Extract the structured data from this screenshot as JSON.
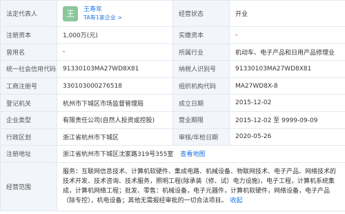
{
  "rows": {
    "legal_rep": {
      "label": "法定代表人",
      "avatar_char": "王",
      "name": "王寿年",
      "sub": "TA有1家企业 >",
      "status_label": "经营状态",
      "status_value": "开业"
    },
    "capital": {
      "label": "注册资本",
      "value": "1,000万(元)",
      "label2": "实缴资本",
      "value2": "-"
    },
    "former_name": {
      "label": "曾用名",
      "value": "-",
      "label2": "所属行业",
      "value2": "机动车、电子产品和日用产品修理业"
    },
    "credit_code": {
      "label": "统一社会信用代码",
      "value": "91330103MA27WD8X81",
      "label2": "纳税人识别号",
      "value2": "91330103MA27WD8X81"
    },
    "reg_no": {
      "label": "工商注册号",
      "value": "330103000276518",
      "label2": "组织机构代码",
      "value2": "MA27WD8X-8"
    },
    "authority": {
      "label": "登记机关",
      "value": "杭州市下城区市场监督管理局",
      "label2": "成立日期",
      "value2": "2015-12-02"
    },
    "type": {
      "label": "企业类型",
      "value": "有限责任公司(自然人投资或控股)",
      "label2": "营业期限",
      "value2": "2015-12-02 至 9999-09-09"
    },
    "region": {
      "label": "行政区划",
      "value": "浙江省杭州市下城区",
      "label2": "审核/年检日期",
      "value2": "2020-05-26"
    },
    "address": {
      "label": "注册地址",
      "value": "浙江省杭州市下城区沈家路319号355室",
      "map_link": "查看地图"
    },
    "scope": {
      "label": "经营范围",
      "value": "服务：互联网信息技术、计算机软硬件、集成电路、机械设备、物联网技术、电子产品、网络技术的技术开发、技术咨询、技术服务，照明工程(除承装（修、试）电力设施)，电子工程，计算机系统集成，计算机网络工程；批发、零售：机械设备，电子元器件，计算机软硬件，网络设备，电子产品（除专控），机电设备；其他无需报经审批的一切合法项目。",
      "collapse": "收起"
    }
  },
  "colors": {
    "label_bg": "#f2f6fb",
    "border": "#e4e8ee",
    "link": "#1a73e8",
    "avatar_bg": "#8bc79a"
  }
}
